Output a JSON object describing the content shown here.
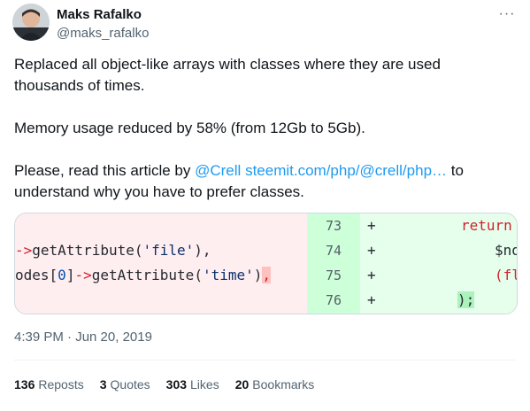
{
  "author": {
    "name": "Maks Rafalko",
    "handle": "@maks_rafalko"
  },
  "more_icon": "more-dots-icon",
  "tweet": {
    "para1": "Replaced all object-like arrays with classes where they are used thousands of times.",
    "para2": "Memory usage reduced by 58% (from 12Gb to 5Gb).",
    "para3_before": "Please, read this article by ",
    "mention": "@Crell",
    "space": " ",
    "url": "steemit.com/php/@crell/php…",
    "para3_after": " to understand why you have to prefer classes."
  },
  "code": {
    "left_lines": [
      "",
      "->getAttribute('file'),",
      "odes[0]->getAttribute('time'),",
      ""
    ],
    "line_numbers": [
      "73",
      "74",
      "75",
      "76"
    ],
    "plus": [
      "+",
      "+",
      "+",
      "+"
    ],
    "right_lines": [
      "return T",
      "$nod",
      "(flo",
      ");"
    ]
  },
  "timestamp": "4:39 PM · Jun 20, 2019",
  "stats": {
    "reposts_count": "136",
    "reposts_label": "Reposts",
    "quotes_count": "3",
    "quotes_label": "Quotes",
    "likes_count": "303",
    "likes_label": "Likes",
    "bookmarks_count": "20",
    "bookmarks_label": "Bookmarks"
  },
  "colors": {
    "link": "#1d9bf0",
    "diff_removed_bg": "#ffeef0",
    "diff_added_bg": "#e6ffec",
    "diff_added_gutter": "#cdffd8"
  }
}
